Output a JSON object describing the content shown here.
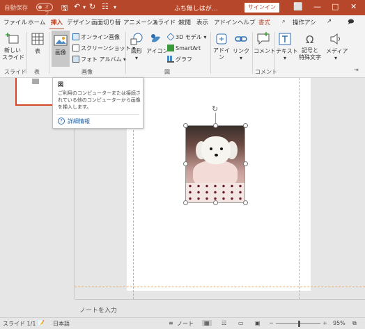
{
  "titlebar": {
    "autosave_label": "自動保存",
    "autosave_state": "オフ",
    "doc_title": "ふち無しはが…",
    "signin_label": "サインイン",
    "colors": {
      "accent": "#b7472a"
    }
  },
  "tabs": [
    "ファイル",
    "ホーム",
    "挿入",
    "デザイン",
    "画面切り替",
    "アニメーショ",
    "スライド シ",
    "校閲",
    "表示",
    "アドイン",
    "ヘルプ",
    "書式"
  ],
  "active_tab": "挿入",
  "tell_me": "操作アシ",
  "ribbon": {
    "new_slide": "新しい\nスライド",
    "table": "表",
    "image": "画像",
    "online_image": "オンライン画像",
    "screenshot": "スクリーンショット",
    "photo_album": "フォト アルバム",
    "shapes": "図形",
    "icons": "アイコン",
    "model3d": "3D モデル",
    "smartart": "SmartArt",
    "graph": "グラフ",
    "addin": "アドイ\nン",
    "link": "リンク",
    "comment": "コメント",
    "text": "テキスト",
    "symbols": "記号と\n特殊文字",
    "media": "メディア",
    "groups": {
      "slides": "スライド",
      "table": "表",
      "images": "画像",
      "illustrations": "図",
      "comments": "コメント"
    }
  },
  "tooltip": {
    "title": "図",
    "body": "ご利用のコンピューターまたは接続されている他のコンピューターから画像を挿入します。",
    "link": "詳細情報"
  },
  "notes_placeholder": "ノートを入力",
  "status": {
    "slide": "スライド 1/1",
    "language": "日本語",
    "notes": "ノート",
    "zoom": "95%"
  }
}
